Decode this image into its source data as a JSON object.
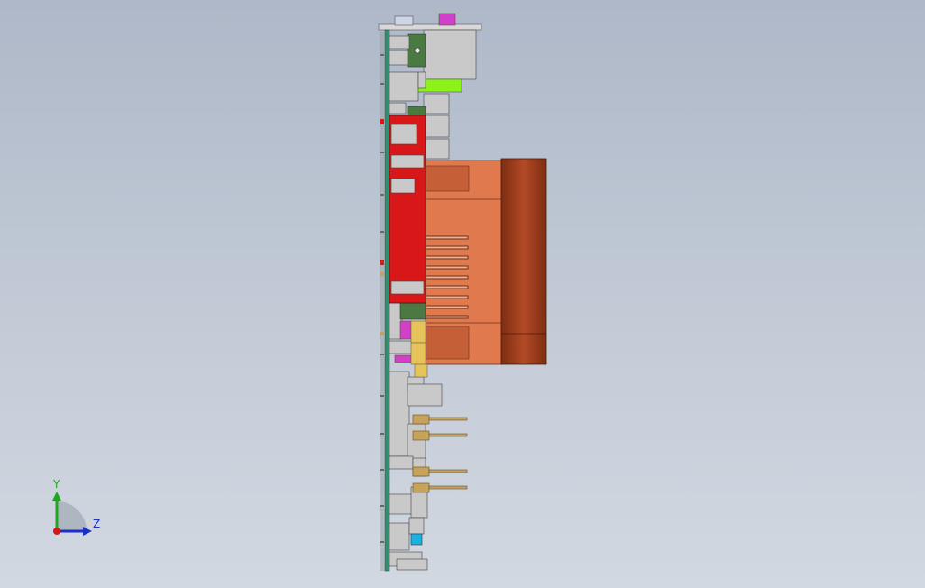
{
  "viewport": {
    "background_top": "#aeb8c8",
    "background_bottom": "#d2d8e1"
  },
  "model": {
    "description_icon": "pcb-assembly-side-view",
    "colors": {
      "pcb": "#2f8f6f",
      "heatsink": "#e07a4e",
      "fan": "#9c3d1e",
      "red_block": "#d81818",
      "connector_grey": "#c9c9c9",
      "lime_part": "#8ef21a",
      "magenta_part": "#d040c8",
      "gold_pins": "#c7a25a",
      "cyan_part": "#19b3e0",
      "dark_green": "#4a7a42"
    }
  },
  "triad": {
    "y_label": "Y",
    "z_label": "Z",
    "y_color": "#1fa81f",
    "z_color": "#1b2fc9",
    "origin_color": "#d11a1a"
  }
}
